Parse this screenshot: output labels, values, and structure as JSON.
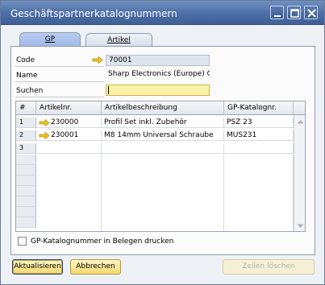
{
  "window": {
    "title": "Geschäftspartnerkatalognummern"
  },
  "tabs": [
    {
      "label": "GP"
    },
    {
      "label": "Artikel"
    }
  ],
  "form": {
    "code_label": "Code",
    "code_value": "70001",
    "name_label": "Name",
    "name_value": "Sharp Electronics (Europe) G",
    "search_label": "Suchen",
    "search_value": ""
  },
  "table": {
    "headers": [
      "#",
      "Artikelnr.",
      "Artikelbeschreibung",
      "GP-Katalognr."
    ],
    "rows": [
      {
        "num": "1",
        "item": "230000",
        "desc": "Profil Set inkl. Zubehör",
        "catalog": "PSZ 23"
      },
      {
        "num": "2",
        "item": "230001",
        "desc": "M8 14mm Universal Schraube",
        "catalog": "MUS231"
      },
      {
        "num": "3",
        "item": "",
        "desc": "",
        "catalog": ""
      }
    ]
  },
  "checkbox": {
    "label": "GP-Katalognummer in Belegen drucken",
    "checked": false
  },
  "buttons": {
    "update": "Aktualisieren",
    "cancel": "Abbrechen",
    "delete_rows": "Zeilen löschen"
  },
  "colors": {
    "titlebar": "#4d6ea6",
    "link_arrow": "#f0c419",
    "button_yellow": "#f3d96d",
    "search_field": "#fbf1a8"
  },
  "icons": [
    "minimize-icon",
    "maximize-icon",
    "close-icon",
    "link-arrow-icon",
    "scroll-up-icon",
    "scroll-down-icon"
  ]
}
